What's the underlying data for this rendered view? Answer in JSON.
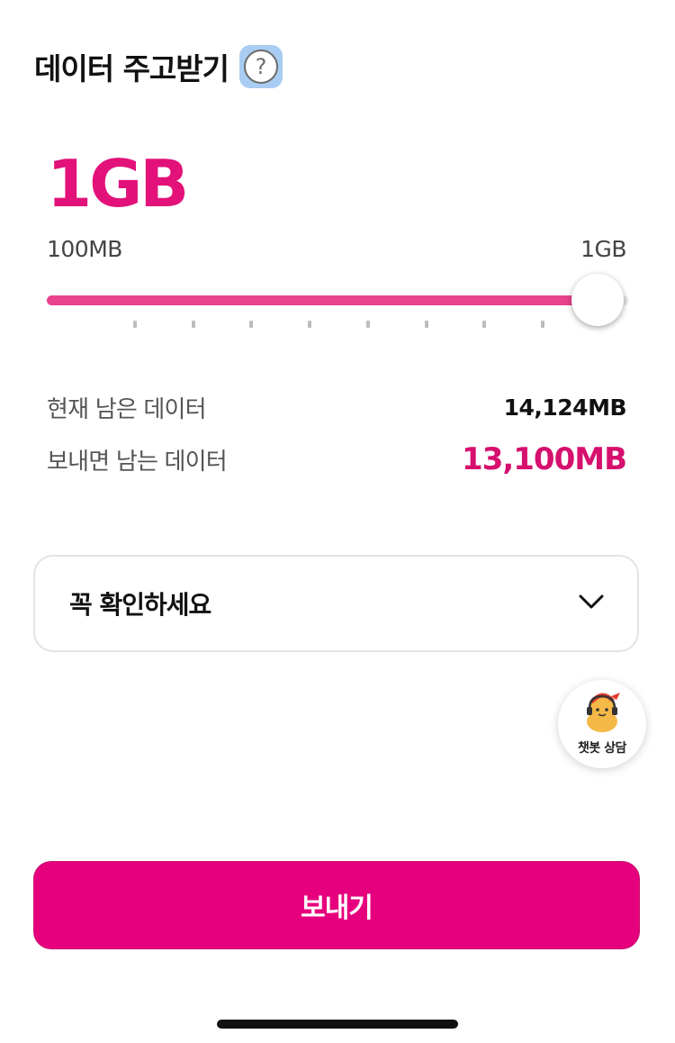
{
  "header": {
    "title": "데이터 주고받기"
  },
  "selected_amount": "1GB",
  "slider": {
    "min_label": "100MB",
    "max_label": "1GB",
    "value_fraction": 1.0,
    "tick_count": 8,
    "fill_color": "#e9438f"
  },
  "info": {
    "current_label": "현재 남은 데이터",
    "current_value": "14,124MB",
    "after_label": "보내면 남는 데이터",
    "after_value": "13,100MB"
  },
  "notice": {
    "label": "꼭 확인하세요",
    "icon": "chevron-down-icon"
  },
  "chatbot": {
    "label": "챗봇 상담",
    "icon": "chatbot-character-icon"
  },
  "send_button": {
    "label": "보내기"
  },
  "colors": {
    "accent": "#e6007e",
    "amount": "#e2127a",
    "remaining": "#d6106e"
  }
}
